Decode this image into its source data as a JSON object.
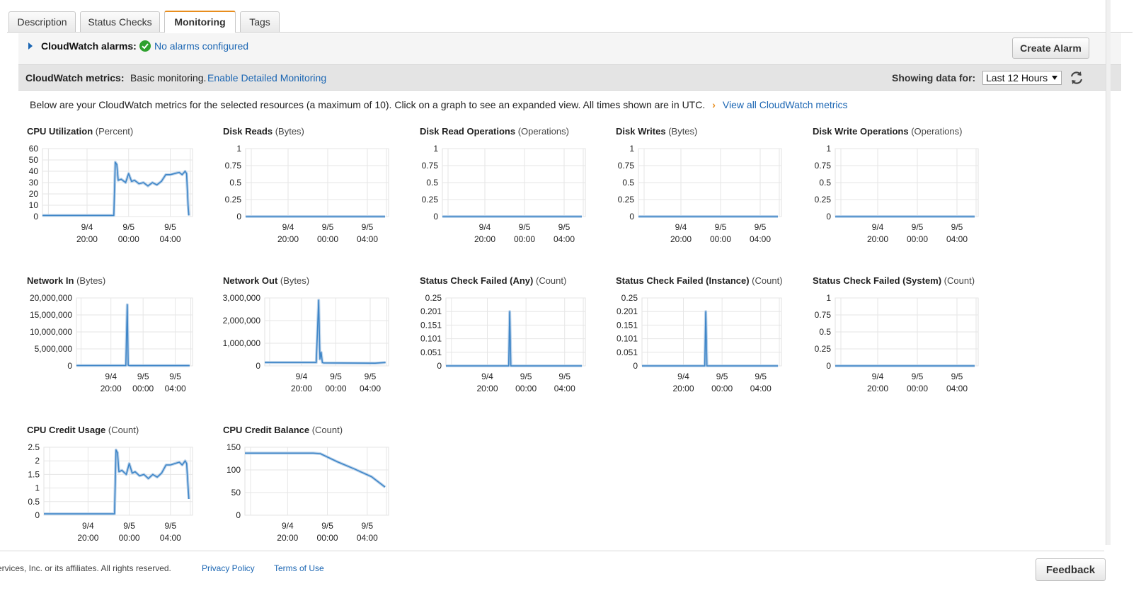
{
  "tabs": [
    {
      "label": "Description",
      "active": false
    },
    {
      "label": "Status Checks",
      "active": false
    },
    {
      "label": "Monitoring",
      "active": true
    },
    {
      "label": "Tags",
      "active": false
    }
  ],
  "alarms": {
    "label": "CloudWatch alarms:",
    "status_icon": "check-circle-icon",
    "status_link": "No alarms configured",
    "create_button": "Create Alarm"
  },
  "metrics": {
    "label": "CloudWatch metrics:",
    "mode": "Basic monitoring.",
    "detailed_link": "Enable Detailed Monitoring",
    "showing_label": "Showing data for:",
    "range_value": "Last 12 Hours",
    "refresh_icon": "refresh-icon"
  },
  "info": {
    "text": "Below are your CloudWatch metrics for the selected resources (a maximum of 10). Click on a graph to see an expanded view. All times shown are in UTC.",
    "chevron": "›",
    "link": "View all CloudWatch metrics"
  },
  "chart_data": [
    {
      "type": "line",
      "title": "CPU Utilization",
      "unit": "(Percent)",
      "yticks": [
        "60",
        "50",
        "40",
        "30",
        "20",
        "10",
        "0"
      ],
      "ylim": [
        0,
        60
      ],
      "xticks": [
        [
          "9/4",
          "20:00"
        ],
        [
          "9/5",
          "00:00"
        ],
        [
          "9/5",
          "04:00"
        ]
      ],
      "series": [
        {
          "x": [
            0,
            4.8,
            4.9,
            5.0,
            5.1,
            5.3,
            5.6,
            5.8,
            6.0,
            6.2,
            6.5,
            6.8,
            7.1,
            7.4,
            7.7,
            8.0,
            8.3,
            8.6,
            8.9,
            9.2,
            9.4,
            9.6,
            9.7,
            9.8,
            9.85
          ],
          "y": [
            1,
            1,
            48,
            46,
            32,
            33,
            30,
            38,
            31,
            32,
            29,
            30,
            27,
            30,
            28,
            31,
            37,
            37,
            38,
            39,
            37,
            40,
            38,
            10,
            1
          ]
        }
      ]
    },
    {
      "type": "line",
      "title": "Disk Reads",
      "unit": "(Bytes)",
      "yticks": [
        "1",
        "0.75",
        "0.5",
        "0.25",
        "0"
      ],
      "ylim": [
        0,
        1
      ],
      "xticks": [
        [
          "9/4",
          "20:00"
        ],
        [
          "9/5",
          "00:00"
        ],
        [
          "9/5",
          "04:00"
        ]
      ],
      "series": [
        {
          "x": [
            0,
            9.85
          ],
          "y": [
            0,
            0
          ]
        }
      ]
    },
    {
      "type": "line",
      "title": "Disk Read Operations",
      "unit": "(Operations)",
      "yticks": [
        "1",
        "0.75",
        "0.5",
        "0.25",
        "0"
      ],
      "ylim": [
        0,
        1
      ],
      "xticks": [
        [
          "9/4",
          "20:00"
        ],
        [
          "9/5",
          "00:00"
        ],
        [
          "9/5",
          "04:00"
        ]
      ],
      "series": [
        {
          "x": [
            0,
            9.85
          ],
          "y": [
            0,
            0
          ]
        }
      ]
    },
    {
      "type": "line",
      "title": "Disk Writes",
      "unit": "(Bytes)",
      "yticks": [
        "1",
        "0.75",
        "0.5",
        "0.25",
        "0"
      ],
      "ylim": [
        0,
        1
      ],
      "xticks": [
        [
          "9/4",
          "20:00"
        ],
        [
          "9/5",
          "00:00"
        ],
        [
          "9/5",
          "04:00"
        ]
      ],
      "series": [
        {
          "x": [
            0,
            9.85
          ],
          "y": [
            0,
            0
          ]
        }
      ]
    },
    {
      "type": "line",
      "title": "Disk Write Operations",
      "unit": "(Operations)",
      "yticks": [
        "1",
        "0.75",
        "0.5",
        "0.25",
        "0"
      ],
      "ylim": [
        0,
        1
      ],
      "xticks": [
        [
          "9/4",
          "20:00"
        ],
        [
          "9/5",
          "00:00"
        ],
        [
          "9/5",
          "04:00"
        ]
      ],
      "series": [
        {
          "x": [
            0,
            9.85
          ],
          "y": [
            0,
            0
          ]
        }
      ]
    },
    {
      "type": "line",
      "title": "Network In",
      "unit": "(Bytes)",
      "yticks": [
        "20,000,000",
        "15,000,000",
        "10,000,000",
        "5,000,000",
        "0"
      ],
      "ylim": [
        0,
        20000000
      ],
      "xticks": [
        [
          "9/4",
          "20:00"
        ],
        [
          "9/5",
          "00:00"
        ],
        [
          "9/5",
          "04:00"
        ]
      ],
      "series": [
        {
          "x": [
            0,
            4.3,
            4.42,
            4.5,
            4.58,
            4.7,
            9.85
          ],
          "y": [
            100000,
            100000,
            18000000,
            200000,
            100000,
            80000,
            80000
          ]
        }
      ]
    },
    {
      "type": "line",
      "title": "Network Out",
      "unit": "(Bytes)",
      "yticks": [
        "3,000,000",
        "2,000,000",
        "1,000,000",
        "0"
      ],
      "ylim": [
        0,
        3000000
      ],
      "xticks": [
        [
          "9/4",
          "20:00"
        ],
        [
          "9/5",
          "00:00"
        ],
        [
          "9/5",
          "04:00"
        ]
      ],
      "series": [
        {
          "x": [
            0,
            4.2,
            4.4,
            4.5,
            4.6,
            4.7,
            4.8,
            9.0,
            9.85
          ],
          "y": [
            150000,
            150000,
            2900000,
            300000,
            600000,
            150000,
            130000,
            120000,
            150000
          ]
        }
      ]
    },
    {
      "type": "line",
      "title": "Status Check Failed (Any)",
      "unit": "(Count)",
      "yticks": [
        "0.25",
        "0.201",
        "0.151",
        "0.101",
        "0.051",
        "0"
      ],
      "ylim": [
        0,
        0.25
      ],
      "xticks": [
        [
          "9/4",
          "20:00"
        ],
        [
          "9/5",
          "00:00"
        ],
        [
          "9/5",
          "04:00"
        ]
      ],
      "series": [
        {
          "x": [
            0,
            4.55,
            4.62,
            4.7,
            9.85
          ],
          "y": [
            0,
            0,
            0.2,
            0,
            0
          ]
        }
      ]
    },
    {
      "type": "line",
      "title": "Status Check Failed (Instance)",
      "unit": "(Count)",
      "yticks": [
        "0.25",
        "0.201",
        "0.151",
        "0.101",
        "0.051",
        "0"
      ],
      "ylim": [
        0,
        0.25
      ],
      "xticks": [
        [
          "9/4",
          "20:00"
        ],
        [
          "9/5",
          "00:00"
        ],
        [
          "9/5",
          "04:00"
        ]
      ],
      "series": [
        {
          "x": [
            0,
            4.55,
            4.62,
            4.7,
            9.85
          ],
          "y": [
            0,
            0,
            0.2,
            0,
            0
          ]
        }
      ]
    },
    {
      "type": "line",
      "title": "Status Check Failed (System)",
      "unit": "(Count)",
      "yticks": [
        "1",
        "0.75",
        "0.5",
        "0.25",
        "0"
      ],
      "ylim": [
        0,
        1
      ],
      "xticks": [
        [
          "9/4",
          "20:00"
        ],
        [
          "9/5",
          "00:00"
        ],
        [
          "9/5",
          "04:00"
        ]
      ],
      "series": [
        {
          "x": [
            0,
            9.85
          ],
          "y": [
            0,
            0
          ]
        }
      ]
    },
    {
      "type": "line",
      "title": "CPU Credit Usage",
      "unit": "(Count)",
      "yticks": [
        "2.5",
        "2",
        "1.5",
        "1",
        "0.5",
        "0"
      ],
      "ylim": [
        0,
        2.5
      ],
      "xticks": [
        [
          "9/4",
          "20:00"
        ],
        [
          "9/5",
          "00:00"
        ],
        [
          "9/5",
          "04:00"
        ]
      ],
      "series": [
        {
          "x": [
            0,
            4.8,
            4.9,
            5.0,
            5.1,
            5.3,
            5.6,
            5.8,
            6.0,
            6.2,
            6.5,
            6.8,
            7.1,
            7.4,
            7.7,
            8.0,
            8.3,
            8.6,
            8.9,
            9.2,
            9.4,
            9.6,
            9.7,
            9.8,
            9.85
          ],
          "y": [
            0.05,
            0.05,
            2.4,
            2.3,
            1.6,
            1.65,
            1.5,
            1.9,
            1.55,
            1.6,
            1.45,
            1.5,
            1.35,
            1.5,
            1.4,
            1.55,
            1.85,
            1.85,
            1.9,
            1.95,
            1.85,
            2.0,
            1.9,
            1.0,
            0.6
          ]
        }
      ]
    },
    {
      "type": "line",
      "title": "CPU Credit Balance",
      "unit": "(Count)",
      "yticks": [
        "150",
        "100",
        "50",
        "0"
      ],
      "ylim": [
        0,
        150
      ],
      "xticks": [
        [
          "9/4",
          "20:00"
        ],
        [
          "9/5",
          "00:00"
        ],
        [
          "9/5",
          "04:00"
        ]
      ],
      "series": [
        {
          "x": [
            0,
            4.8,
            5.3,
            6.5,
            7.7,
            8.9,
            9.85
          ],
          "y": [
            137,
            137,
            136,
            118,
            102,
            85,
            62
          ]
        }
      ]
    }
  ],
  "footer": {
    "copyright": "ervices, Inc. or its affiliates. All rights reserved.",
    "privacy": "Privacy Policy",
    "terms": "Terms of Use",
    "feedback": "Feedback"
  }
}
